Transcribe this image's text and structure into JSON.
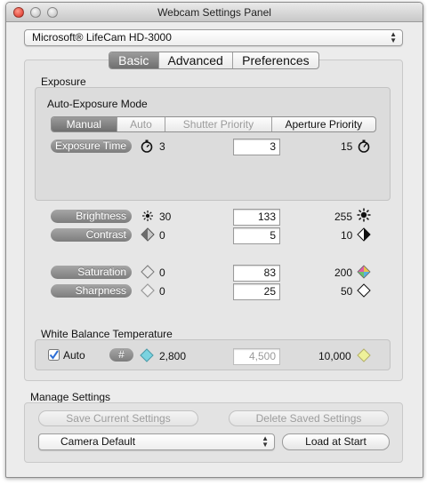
{
  "window": {
    "title": "Webcam Settings Panel"
  },
  "camera_select": {
    "value": "Microsoft® LifeCam HD-3000"
  },
  "tabs": [
    {
      "label": "Basic",
      "selected": true
    },
    {
      "label": "Advanced",
      "selected": false
    },
    {
      "label": "Preferences",
      "selected": false
    }
  ],
  "exposure": {
    "section_label": "Exposure",
    "mode_label": "Auto-Exposure Mode",
    "modes": [
      {
        "label": "Manual",
        "selected": true,
        "enabled": true
      },
      {
        "label": "Auto",
        "selected": false,
        "enabled": false
      },
      {
        "label": "Shutter Priority",
        "selected": false,
        "enabled": false
      },
      {
        "label": "Aperture Priority",
        "selected": false,
        "enabled": true
      }
    ],
    "time": {
      "label": "Exposure Time",
      "min": "3",
      "value": "3",
      "max": "15"
    }
  },
  "controls": {
    "brightness": {
      "label": "Brightness",
      "min": "30",
      "value": "133",
      "max": "255"
    },
    "contrast": {
      "label": "Contrast",
      "min": "0",
      "value": "5",
      "max": "10"
    },
    "saturation": {
      "label": "Saturation",
      "min": "0",
      "value": "83",
      "max": "200"
    },
    "sharpness": {
      "label": "Sharpness",
      "min": "0",
      "value": "25",
      "max": "50"
    }
  },
  "white_balance": {
    "section_label": "White Balance Temperature",
    "auto_label": "Auto",
    "auto_checked": true,
    "hash_label": "#",
    "min": "2,800",
    "value": "4,500",
    "max": "10,000"
  },
  "manage": {
    "section_label": "Manage Settings",
    "save_label": "Save Current Settings",
    "delete_label": "Delete Saved Settings",
    "preset_value": "Camera Default",
    "load_label": "Load at Start"
  },
  "colors": {
    "accent_check": "#2f6fd6",
    "cool_diamond": "#7ad3e0",
    "warm_diamond": "#eef19a"
  },
  "icons": [
    "stopwatch-icon",
    "sun-small-icon",
    "sun-large-icon",
    "contrast-low-icon",
    "contrast-high-icon",
    "diamond-outline-icon",
    "diamond-color-icon",
    "diamond-cool-icon",
    "diamond-warm-icon"
  ]
}
